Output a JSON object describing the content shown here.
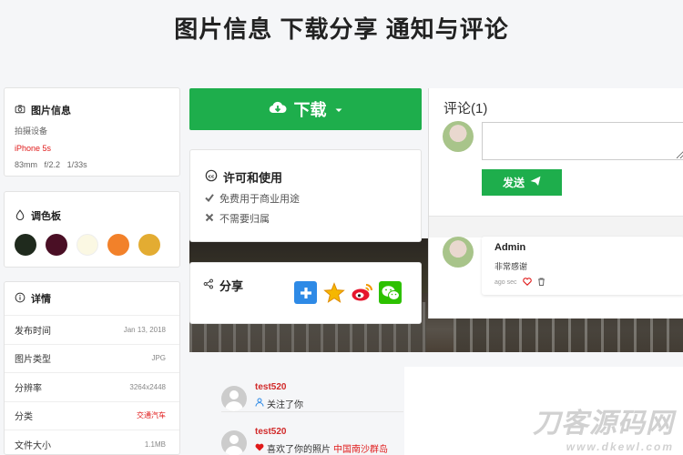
{
  "page_title": "图片信息 下载分享 通知与评论",
  "info": {
    "title": "图片信息",
    "device_label": "拍摄设备",
    "device": "iPhone 5s",
    "focal": "83mm",
    "aperture": "f/2.2",
    "shutter": "1/33s"
  },
  "palette": {
    "title": "调色板",
    "colors": [
      "#1f2a1d",
      "#4a0f25",
      "#fbf8e3",
      "#f2812a",
      "#e3ac32"
    ]
  },
  "details": {
    "title": "详情",
    "rows": [
      {
        "label": "发布时间",
        "value": "Jan 13, 2018"
      },
      {
        "label": "图片类型",
        "value": "JPG"
      },
      {
        "label": "分辨率",
        "value": "3264x2448"
      },
      {
        "label": "分类",
        "value": "交通汽车"
      },
      {
        "label": "文件大小",
        "value": "1.1MB"
      }
    ]
  },
  "download": {
    "label": "下载"
  },
  "license": {
    "title": "许可和使用",
    "items": [
      "免费用于商业用途",
      "不需要归属"
    ]
  },
  "share": {
    "title": "分享",
    "icons": [
      "plus-share-icon",
      "qzone-icon",
      "weibo-icon",
      "wechat-icon"
    ]
  },
  "comments": {
    "title": "评论(1)",
    "input_placeholder": "",
    "send_label": "发送",
    "items": [
      {
        "author": "Admin",
        "text": "非常感谢",
        "time": "ago sec"
      }
    ]
  },
  "activity": [
    {
      "user": "test520",
      "action": "关注了你",
      "target": ""
    },
    {
      "user": "test520",
      "action": "喜欢了你的照片",
      "target": "中国南沙群岛"
    }
  ],
  "watermark": {
    "line1": "刀客源码网",
    "line2": "www.dkewl.com"
  },
  "colors": {
    "accent": "#1eae4c",
    "danger": "#e01a1a"
  }
}
